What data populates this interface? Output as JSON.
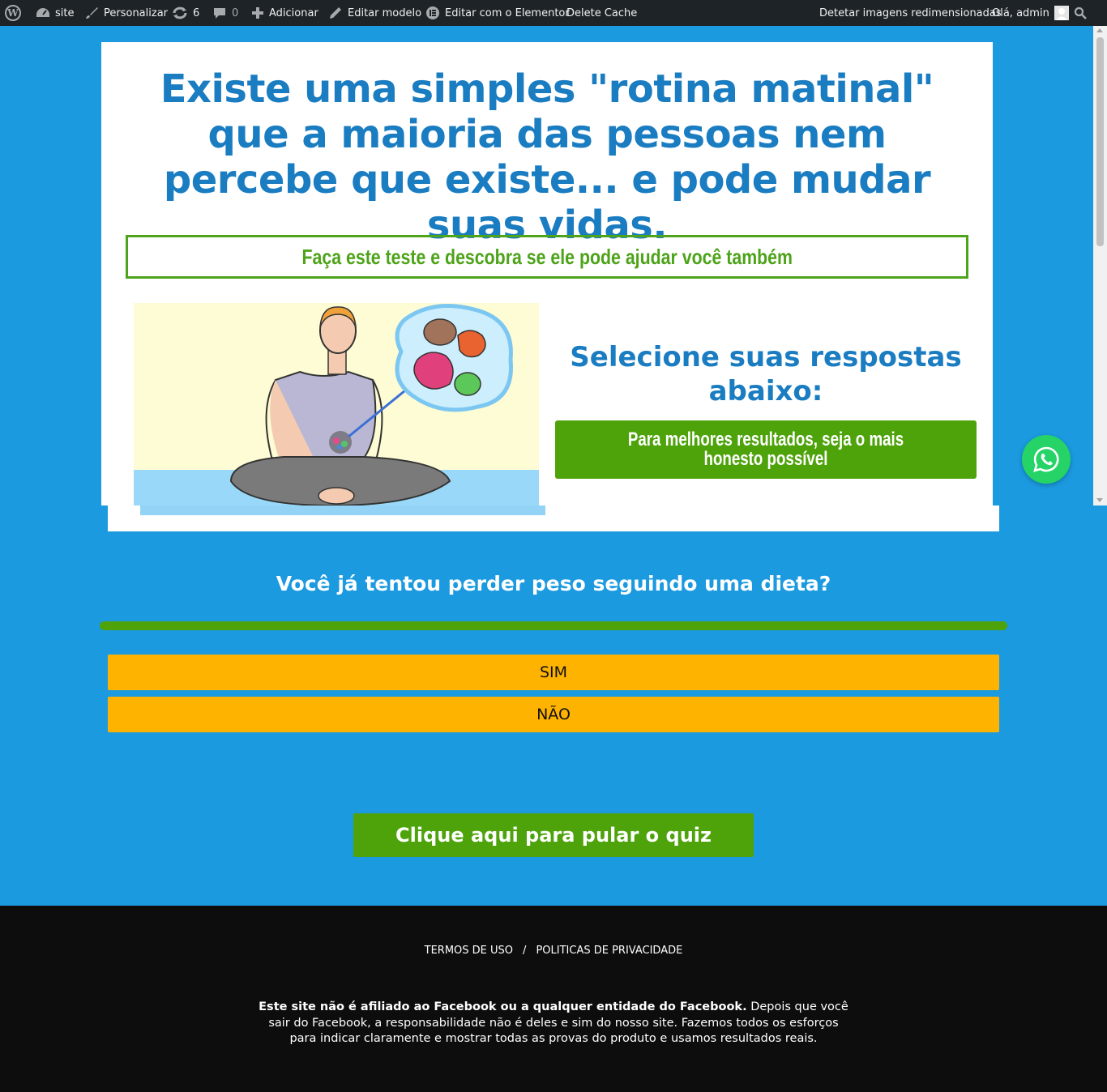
{
  "adminbar": {
    "site": "site",
    "customize": "Personalizar",
    "updates_count": "6",
    "comments_count": "0",
    "add_new": "Adicionar",
    "edit_template": "Editar modelo",
    "edit_elementor": "Editar com o Elementor",
    "delete_cache": "Delete Cache",
    "detect_images": "Detetar imagens redimensionadas",
    "greeting": "Olá, admin"
  },
  "hero": {
    "headline": "Existe uma simples \"rotina matinal\" que a maioria das pessoas nem percebe que existe... e pode mudar suas vidas.",
    "test_banner": "Faça este teste e descobra se ele pode ajudar você também",
    "select_title": "Selecione suas respostas abaixo:",
    "honesty_note": "Para melhores resultados, seja o mais honesto possível"
  },
  "quiz": {
    "question": "Você já tentou perder peso seguindo uma dieta?",
    "progress": 1.0,
    "answers": [
      "SIM",
      "NÃO"
    ],
    "skip_label": "Clique aqui para pular o quiz"
  },
  "footer": {
    "links": [
      "TERMOS DE USO",
      "POLITICAS DE PRIVACIDADE"
    ],
    "separator": "/",
    "disclaimer_bold": "Este site não é afiliado ao Facebook ou a qualquer entidade do Facebook.",
    "disclaimer_rest": "Depois que você sair do Facebook, a responsabilidade não é deles e sim do nosso site. Fazemos todos os esforços para indicar claramente e mostrar todas as provas do produto e usamos resultados reais."
  },
  "colors": {
    "background": "#1b9ae0",
    "headline": "#1a7cc1",
    "green": "#4ea30b",
    "answer": "#ffb301",
    "footer": "#0d0d0d",
    "whatsapp": "#25d366"
  },
  "icons": [
    "wordpress-icon",
    "dashboard-icon",
    "brush-icon",
    "updates-icon",
    "comment-icon",
    "plus-icon",
    "pencil-icon",
    "elementor-icon",
    "avatar",
    "search-icon",
    "whatsapp-icon"
  ]
}
